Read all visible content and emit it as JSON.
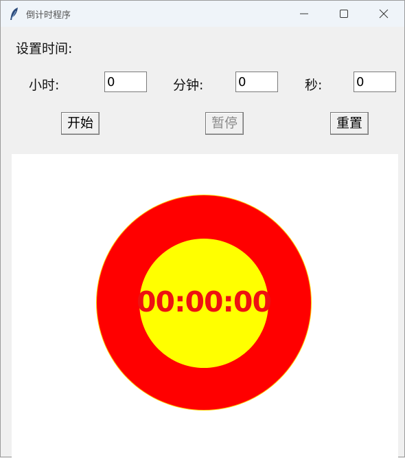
{
  "window": {
    "title": "倒计时程序"
  },
  "form": {
    "set_time_label": "设置时间:",
    "hours_label": "小时:",
    "minutes_label": "分钟:",
    "seconds_label": "秒:",
    "hours_value": "0",
    "minutes_value": "0",
    "seconds_value": "0"
  },
  "buttons": {
    "start": "开始",
    "pause": "暂停",
    "reset": "重置"
  },
  "display": {
    "time": "00:00:00",
    "colors": {
      "outer": "#ff0000",
      "inner": "#ffff00",
      "text": "#ee1111"
    }
  },
  "icons": [
    "feather-icon",
    "minimize-icon",
    "maximize-icon",
    "close-icon"
  ]
}
